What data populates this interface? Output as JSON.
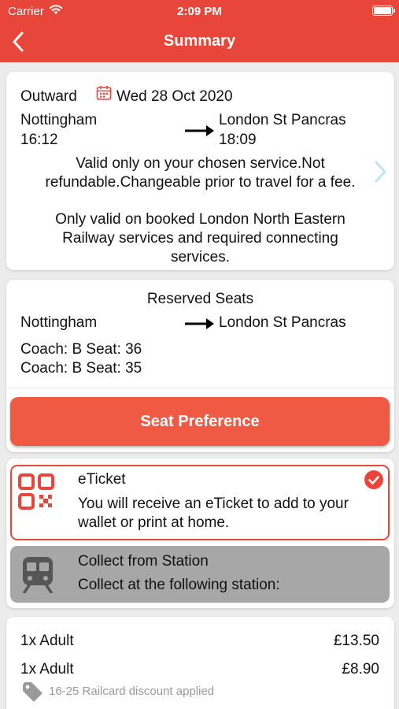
{
  "status_bar": {
    "carrier": "Carrier",
    "time": "2:09 PM"
  },
  "nav": {
    "title": "Summary"
  },
  "journey": {
    "direction": "Outward",
    "date": "Wed 28 Oct 2020",
    "origin": "Nottingham",
    "depart_time": "16:12",
    "destination": "London St Pancras",
    "arrive_time": "18:09",
    "conditions_line1": "Valid only on your chosen service.Not",
    "conditions_line2": "refundable.Changeable prior to travel for a fee.",
    "validity_line1": "Only valid on booked London North Eastern",
    "validity_line2": "Railway services and required connecting",
    "validity_line3": "services."
  },
  "seats": {
    "heading": "Reserved Seats",
    "origin": "Nottingham",
    "destination": "London St Pancras",
    "seat1": "Coach: B Seat: 36",
    "seat2": "Coach: B Seat: 35",
    "button_label": "Seat Preference"
  },
  "delivery": {
    "eticket_title": "eTicket",
    "eticket_desc_line1": "You will receive an eTicket to add to your",
    "eticket_desc_line2": "wallet or print at home.",
    "collect_title": "Collect from Station",
    "collect_desc": "Collect at the following station:"
  },
  "prices": {
    "line1_label": "1x Adult",
    "line1_amount": "£13.50",
    "line2_label": "1x Adult",
    "line2_amount": "£8.90",
    "discount_note": "16-25 Railcard discount applied"
  },
  "colors": {
    "accent": "#e8463a",
    "button": "#f05a45",
    "disabled_option": "#a7a7a7",
    "chevron": "#bfe3f3"
  },
  "icons": [
    "back-chevron-icon",
    "calendar-icon",
    "arrow-right-icon",
    "chevron-right-icon",
    "qr-code-icon",
    "checkmark-circle-icon",
    "train-icon",
    "price-tag-icon",
    "wifi-icon",
    "battery-icon"
  ]
}
